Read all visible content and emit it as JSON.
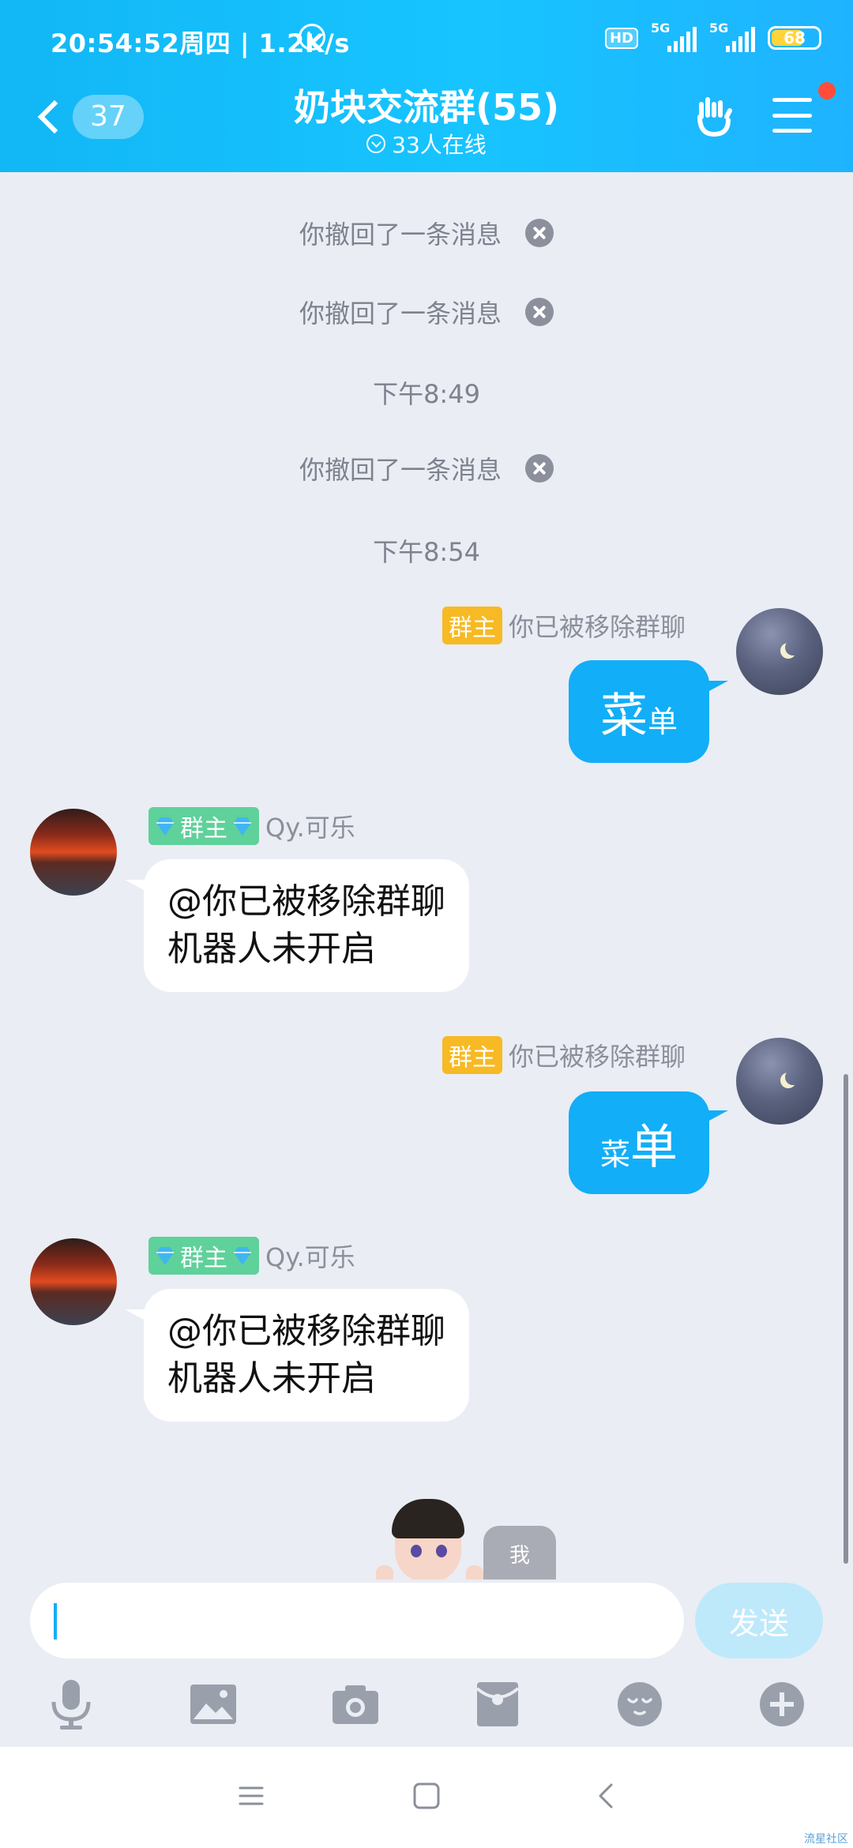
{
  "status_bar": {
    "time": "20:54:52周四 | 1.2K/s",
    "hd": "HD",
    "sim1": "5G",
    "sim2": "5G",
    "battery": "68"
  },
  "header": {
    "unread_count": "37",
    "title": "奶块交流群(55)",
    "online": "33人在线"
  },
  "messages": {
    "recall_1": "你撤回了一条消息",
    "recall_2": "你撤回了一条消息",
    "time_1": "下午8:49",
    "recall_3": "你撤回了一条消息",
    "time_2": "下午8:54",
    "m1_tag": "群主",
    "m1_name": "你已被移除群聊",
    "m1_big": "菜",
    "m1_small": "单",
    "m2_tag": "群主",
    "m2_name": "Qy.可乐",
    "m2_line1": "@你已被移除群聊",
    "m2_line2": "机器人未开启",
    "m3_tag": "群主",
    "m3_name": "你已被移除群聊",
    "m3_small": "菜",
    "m3_big": "单",
    "m4_tag": "群主",
    "m4_name": "Qy.可乐",
    "m4_line1": "@你已被移除群聊",
    "m4_line2": "机器人未开启",
    "sticker_label": "我"
  },
  "input": {
    "placeholder": "",
    "send_label": "发送"
  },
  "watermark": "流星社区",
  "colors": {
    "accent": "#12aef7",
    "owner_tag": "#f7b924",
    "owner_tag_green": "#5fd19a"
  }
}
